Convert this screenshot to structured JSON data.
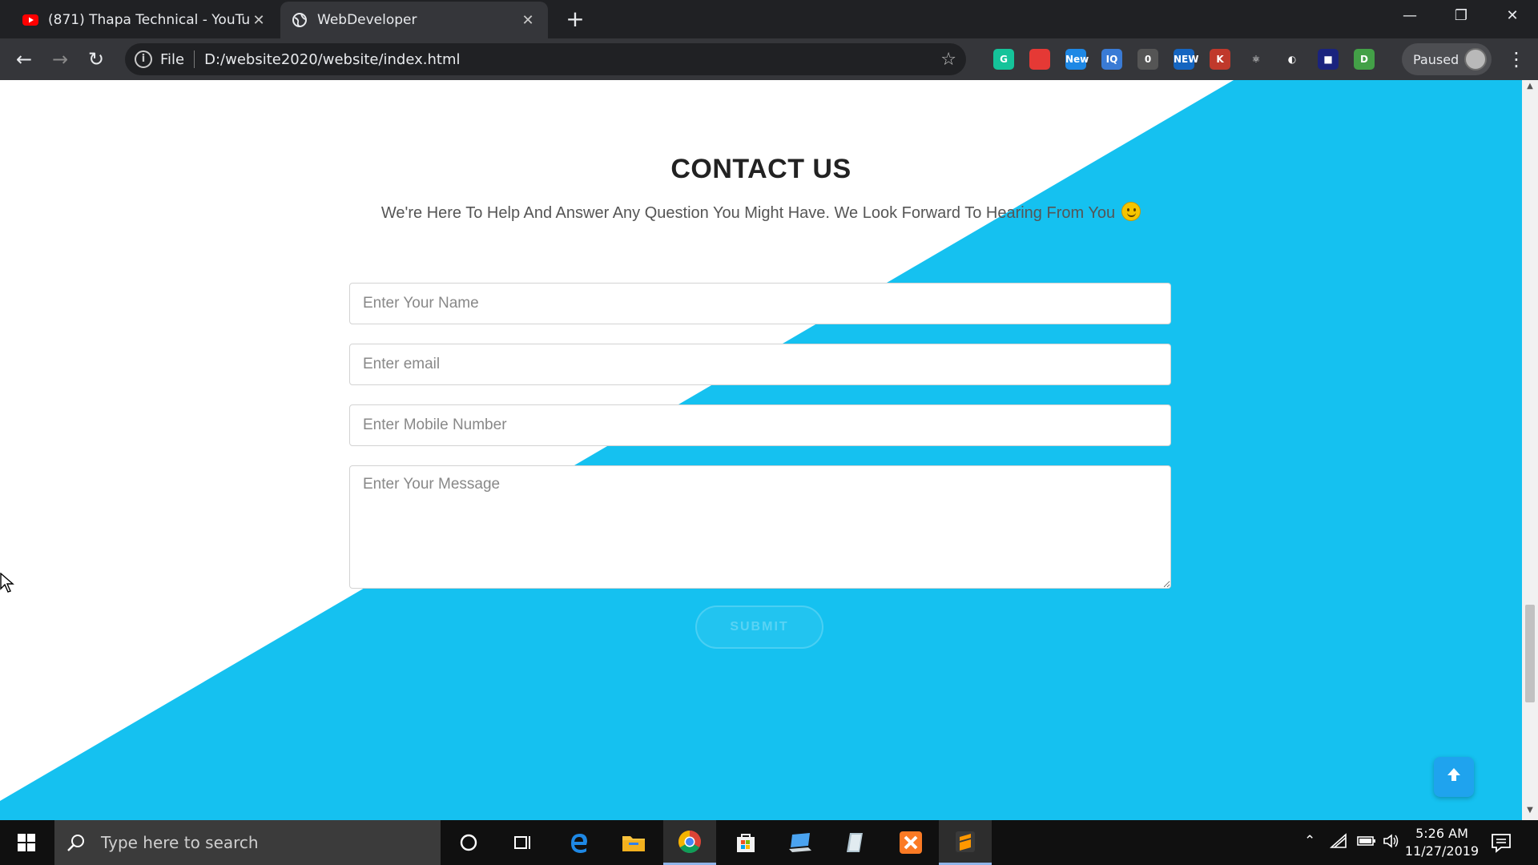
{
  "browser": {
    "tabs": [
      {
        "title": "(871) Thapa Technical - YouTube",
        "favicon": "youtube-icon",
        "active": false
      },
      {
        "title": "WebDeveloper",
        "favicon": "globe-icon",
        "active": true
      }
    ],
    "new_tab": "+",
    "address_bar": {
      "scheme_label": "File",
      "url": "D:/website2020/website/index.html"
    },
    "extensions": [
      {
        "name": "grammarly-icon",
        "label": "G",
        "color": "#15c39a"
      },
      {
        "name": "bookmark-red-icon",
        "label": "",
        "color": "#e53935"
      },
      {
        "name": "mail-new-icon",
        "label": "New",
        "color": "#1e88e5"
      },
      {
        "name": "iq-icon",
        "label": "IQ",
        "color": "#3a7bd5"
      },
      {
        "name": "counter-icon",
        "label": "0",
        "color": "#555555"
      },
      {
        "name": "new-badge-icon",
        "label": "NEW",
        "color": "#1565c0"
      },
      {
        "name": "k-icon",
        "label": "K",
        "color": "#c0392b"
      },
      {
        "name": "react-icon",
        "label": "⚛",
        "color": "#35363a"
      },
      {
        "name": "compass-icon",
        "label": "◐",
        "color": "#35363a"
      },
      {
        "name": "square-blue-icon",
        "label": "■",
        "color": "#1a237e"
      },
      {
        "name": "d-icon",
        "label": "D",
        "color": "#43a047"
      }
    ],
    "profile_label": "Paused"
  },
  "page": {
    "title": "CONTACT US",
    "subtitle": "We're Here To Help And Answer Any Question You Might Have. We Look Forward To Hearing From You",
    "accent_color": "#15c1f0",
    "form": {
      "name_placeholder": "Enter Your Name",
      "email_placeholder": "Enter email",
      "mobile_placeholder": "Enter Mobile Number",
      "message_placeholder": "Enter Your Message",
      "submit_label": "SUBMIT"
    },
    "scroll_top_icon": "arrow-up-icon"
  },
  "taskbar": {
    "search_placeholder": "Type here to search",
    "apps": [
      "cortana-icon",
      "task-view-icon",
      "edge-icon",
      "file-explorer-icon",
      "chrome-icon",
      "store-icon",
      "remote-desktop-icon",
      "notepad-icon",
      "xampp-icon",
      "sublime-icon"
    ],
    "clock_time": "5:26 AM",
    "clock_date": "11/27/2019"
  }
}
